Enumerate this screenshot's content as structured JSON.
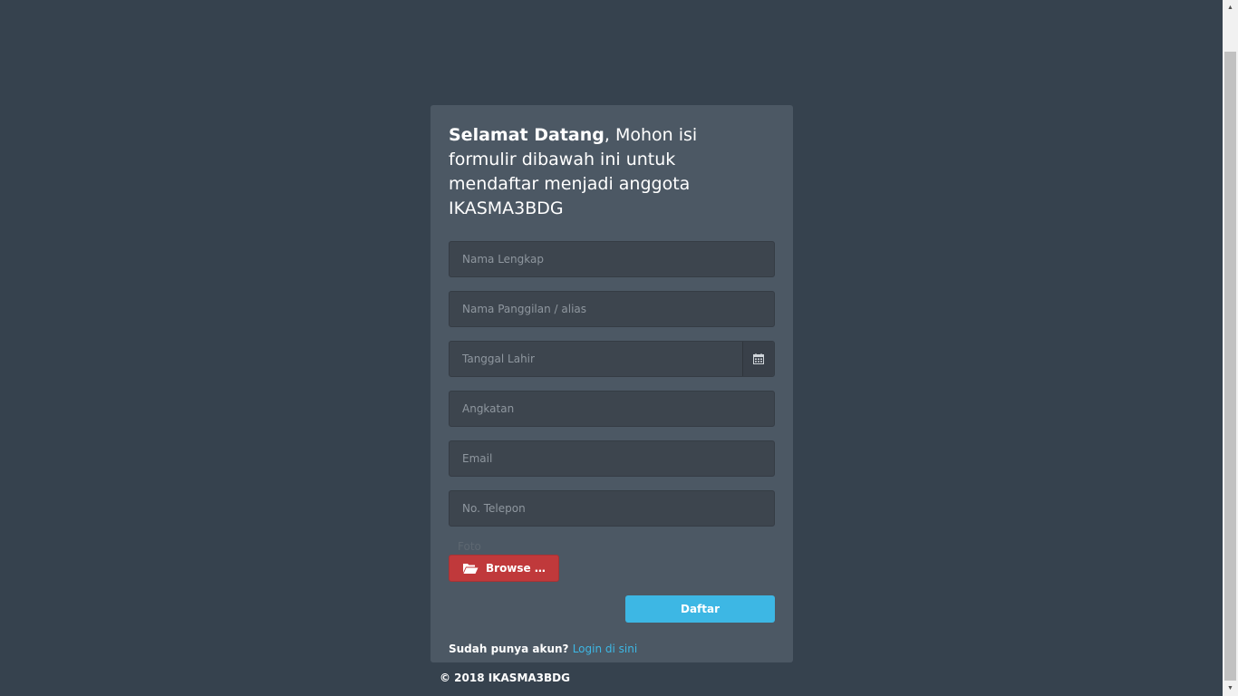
{
  "welcome": {
    "bold": "Selamat Datang",
    "rest": ", Mohon isi formulir dibawah ini untuk mendaftar menjadi anggota IKASMA3BDG"
  },
  "form": {
    "nama_lengkap_placeholder": "Nama Lengkap",
    "nama_panggilan_placeholder": "Nama Panggilan / alias",
    "tanggal_lahir_placeholder": "Tanggal Lahir",
    "angkatan_placeholder": "Angkatan",
    "email_placeholder": "Email",
    "telepon_placeholder": "No. Telepon",
    "foto_label": "Foto",
    "browse_label": "Browse …",
    "submit_label": "Daftar"
  },
  "login": {
    "prompt": "Sudah punya akun?",
    "link": "Login di sini"
  },
  "footer": {
    "copyright": "© 2018 IKASMA3BDG"
  },
  "icons": {
    "calendar": "calendar-icon",
    "folder": "folder-open-icon"
  },
  "colors": {
    "background": "#36424e",
    "card": "#4c5864",
    "browse": "#c0393b",
    "primary": "#3db7e4"
  }
}
